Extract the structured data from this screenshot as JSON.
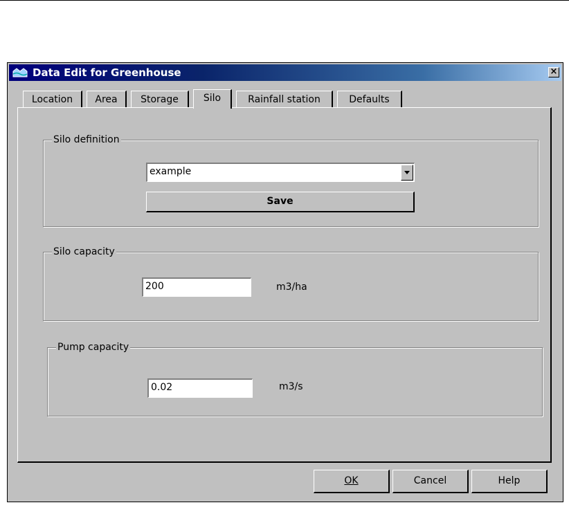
{
  "window": {
    "title": "Data Edit for Greenhouse"
  },
  "tabs": [
    {
      "label": "Location",
      "active": false
    },
    {
      "label": "Area",
      "active": false
    },
    {
      "label": "Storage",
      "active": false
    },
    {
      "label": "Silo",
      "active": true
    },
    {
      "label": "Rainfall station",
      "active": false
    },
    {
      "label": "Defaults",
      "active": false
    }
  ],
  "silo_definition": {
    "legend": "Silo definition",
    "selected": "example",
    "save_label": "Save"
  },
  "silo_capacity": {
    "legend": "Silo capacity",
    "value": "200",
    "unit": "m3/ha"
  },
  "pump_capacity": {
    "legend": "Pump capacity",
    "value": "0.02",
    "unit": "m3/s"
  },
  "footer": {
    "ok_label": "OK",
    "cancel_label": "Cancel",
    "help_label": "Help"
  }
}
